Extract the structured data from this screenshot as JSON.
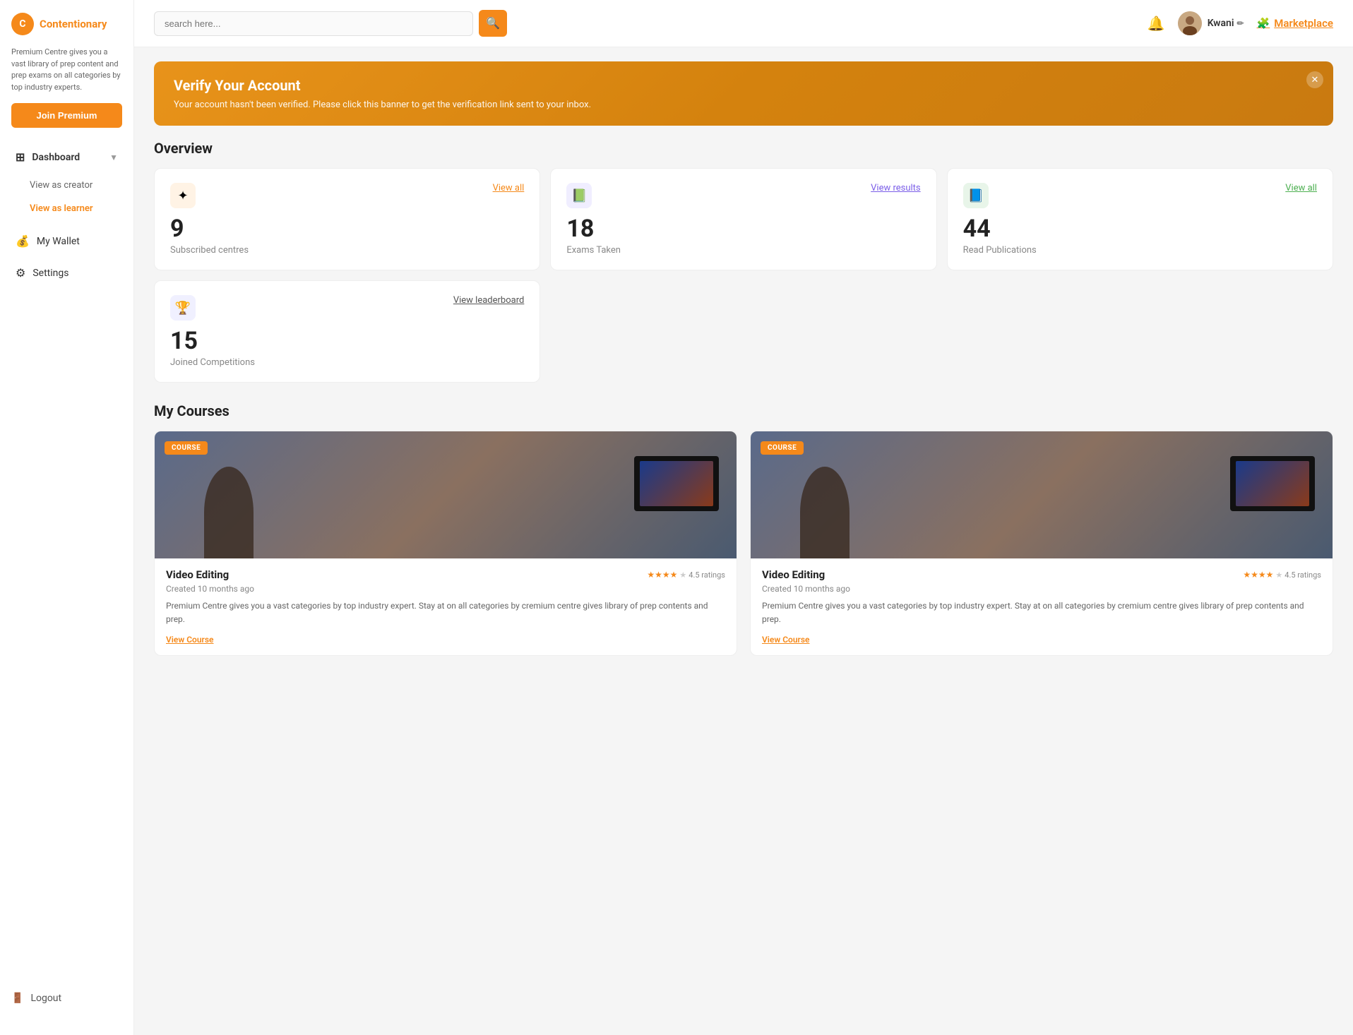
{
  "brand": {
    "logo_letter": "C",
    "name": "Contentionary",
    "tagline": "Premium Centre gives you a vast library of prep content and prep exams on all categories by top industry experts."
  },
  "sidebar": {
    "join_premium_label": "Join Premium",
    "nav_items": [
      {
        "id": "dashboard",
        "label": "Dashboard",
        "icon": "⊞",
        "active": true,
        "has_arrow": true
      },
      {
        "id": "wallet",
        "label": "My Wallet",
        "icon": "💰",
        "active": false
      },
      {
        "id": "settings",
        "label": "Settings",
        "icon": "⚙",
        "active": false
      }
    ],
    "sub_items": [
      {
        "id": "creator",
        "label": "View as creator",
        "active": false
      },
      {
        "id": "learner",
        "label": "View as learner",
        "active": true
      }
    ],
    "logout_label": "Logout",
    "logout_icon": "🚪"
  },
  "header": {
    "search_placeholder": "search here...",
    "search_icon": "🔍",
    "bell_icon": "🔔",
    "user_name": "Kwani",
    "edit_icon": "✏",
    "marketplace_label": "Marketplace",
    "marketplace_icon": "🧩"
  },
  "verify_banner": {
    "title": "Verify Your Account",
    "message": "Your account hasn't been verified. Please click this banner to get the verification link sent to your inbox.",
    "close_icon": "✕"
  },
  "overview": {
    "section_title": "Overview",
    "stats": [
      {
        "id": "subscribed-centres",
        "icon": "✦",
        "icon_style": "orange",
        "link_label": "View all",
        "link_style": "orange",
        "number": "9",
        "label": "Subscribed centres"
      },
      {
        "id": "exams-taken",
        "icon": "📗",
        "icon_style": "purple",
        "link_label": "View results",
        "link_style": "purple",
        "number": "18",
        "label": "Exams Taken"
      },
      {
        "id": "read-publications",
        "icon": "📘",
        "icon_style": "green",
        "link_label": "View all",
        "link_style": "green",
        "number": "44",
        "label": "Read Publications"
      }
    ],
    "bottom_stats": [
      {
        "id": "competitions",
        "icon": "🏆",
        "link_label": "View leaderboard",
        "number": "15",
        "label": "Joined Competitions"
      }
    ]
  },
  "courses": {
    "section_title": "My Courses",
    "items": [
      {
        "id": "course-1",
        "badge": "COURSE",
        "title": "Video Editing",
        "rating_value": "4.5",
        "rating_label": "4.5 ratings",
        "created_label": "Created",
        "created_time": "10 months ago",
        "description": "Premium Centre gives you a vast categories by top industry expert. Stay at on all categories by cremium centre gives library of prep contents and prep.",
        "view_link": "View Course"
      },
      {
        "id": "course-2",
        "badge": "COURSE",
        "title": "Video Editing",
        "rating_value": "4.5",
        "rating_label": "4.5 ratings",
        "created_label": "Created",
        "created_time": "10 months ago",
        "description": "Premium Centre gives you a vast categories by top industry expert. Stay at on all categories by cremium centre gives library of prep contents and prep.",
        "view_link": "View Course"
      }
    ]
  },
  "colors": {
    "primary": "#F5891A",
    "purple": "#7B5EE8",
    "green": "#4CAF50"
  }
}
